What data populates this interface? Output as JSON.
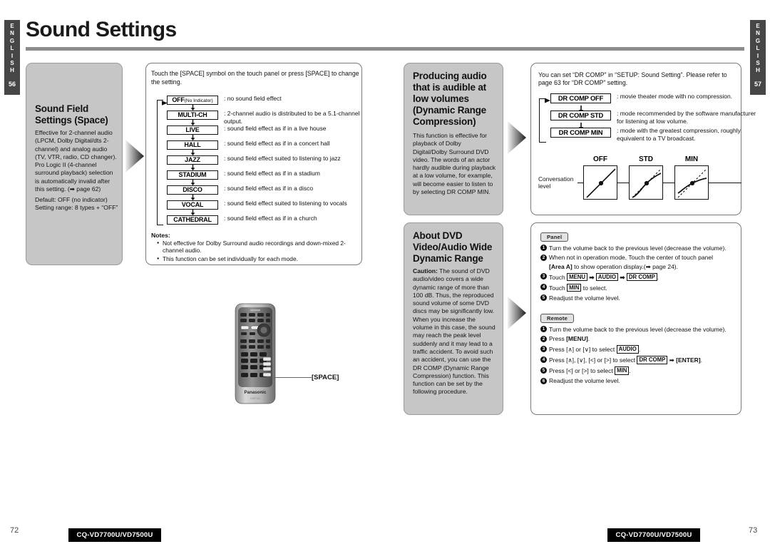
{
  "document": {
    "title": "Sound Settings",
    "left_tab": {
      "letters": [
        "E",
        "N",
        "G",
        "L",
        "I",
        "S",
        "H"
      ],
      "page": "56"
    },
    "right_tab": {
      "letters": [
        "E",
        "N",
        "G",
        "L",
        "I",
        "S",
        "H"
      ],
      "page": "57"
    },
    "footer": {
      "left_page": "72",
      "right_page": "73",
      "left_model": "CQ-VD7700U/VD7500U",
      "right_model": "CQ-VD7700U/VD7500U"
    }
  },
  "sound_field": {
    "heading_line1": "Sound Field",
    "heading_line2": "Settings (Space)",
    "body": "Effective for 2-channel audio (LPCM, Dolby Digital/dts 2-channel) and analog audio (TV, VTR, radio, CD changer). Pro Logic II (4-channel surround playback) selection is automatically invalid after this setting. (➡ page 62)",
    "default_line": "Default: OFF (no indicator)",
    "range_line": "Setting range: 8 types + “OFF”"
  },
  "flow": {
    "intro": "Touch the [SPACE] symbol on the touch panel or press [SPACE] to change the setting.",
    "items": [
      {
        "label": "OFF",
        "sublabel": "(No Indicator)",
        "desc": ": no sound field effect"
      },
      {
        "label": "MULTI-CH",
        "sublabel": "",
        "desc": ": 2-channel audio is distributed to be a 5.1-channel output."
      },
      {
        "label": "LIVE",
        "sublabel": "",
        "desc": ": sound field effect as if in a live house"
      },
      {
        "label": "HALL",
        "sublabel": "",
        "desc": ": sound field effect as if in a concert hall"
      },
      {
        "label": "JAZZ",
        "sublabel": "",
        "desc": ": sound field effect suited to listening to jazz"
      },
      {
        "label": "STADIUM",
        "sublabel": "",
        "desc": ": sound field effect as if in a stadium"
      },
      {
        "label": "DISCO",
        "sublabel": "",
        "desc": ": sound field effect as if in a disco"
      },
      {
        "label": "VOCAL",
        "sublabel": "",
        "desc": ": sound field effect suited to listening to vocals"
      },
      {
        "label": "CATHEDRAL",
        "sublabel": "",
        "desc": ": sound field effect as if in a church"
      }
    ]
  },
  "notes": {
    "heading": "Notes:",
    "items": [
      "Not effective for Dolby Surround audio recordings and down-mixed 2-channel audio.",
      "This function can be set individually for each mode."
    ]
  },
  "remote_figure": {
    "brand": "Panasonic",
    "sub_brand": "CAR AV",
    "callout": "[SPACE]"
  },
  "dynamic_range": {
    "heading_line1": "Producing audio",
    "heading_line2": "that is audible at",
    "heading_line3": "low volumes",
    "heading_line4": "(Dynamic Range",
    "heading_line5": "Compression)",
    "body": "This function is effective for playback of Dolby Digital/Dolby Surround DVD video.  The words of an actor hardly audible during playback at a low volume, for example, will become easier to listen to by selecting DR COMP MIN."
  },
  "about_dvd": {
    "heading_line1": "About DVD",
    "heading_line2": "Video/Audio Wide",
    "heading_line3": "Dynamic Range",
    "caution_label": "Caution:",
    "body": " The sound of DVD audio/video covers a wide dynamic range of more than 100 dB. Thus, the reproduced sound volume of some DVD discs may be significantly low. When you increase the volume in this case, the sound may reach the peak level suddenly and it may lead to a traffic accident. To avoid such an accident, you can use the DR COMP (Dynamic Range Compression) function. This function can be set by the following procedure."
  },
  "dr_comp": {
    "intro": "You can set “DR COMP” in “SETUP: Sound Setting”. Please  refer to page 63 for “DR COMP” setting.",
    "items": [
      {
        "label": "DR COMP OFF",
        "desc": ": movie theater mode with no compression."
      },
      {
        "label": "DR COMP STD",
        "desc": ": mode  recommended  by  the  software manufacturer for listening at low volume."
      },
      {
        "label": "DR COMP MIN",
        "desc": ": mode with the greatest compression, roughly equivalent to a TV broadcast."
      }
    ],
    "graph": {
      "axis_caption_line1": "Conversation",
      "axis_caption_line2": "level",
      "labels": [
        "OFF",
        "STD",
        "MIN"
      ]
    }
  },
  "panel_steps": {
    "tag": "Panel",
    "steps": [
      {
        "num": "❶",
        "text": "Turn the volume back to the previous level (decrease the volume)."
      },
      {
        "num": "❷",
        "text": "When not in operation mode, Touch the center of touch panel"
      },
      {
        "num": "❸",
        "text": "Touch"
      },
      {
        "num": "❹",
        "text": "Touch"
      },
      {
        "num": "❺",
        "text": "Readjust the volume level."
      }
    ],
    "step2_sub_bold": "[Area A]",
    "step2_sub_rest": " to show operation display.(➡  page 24).",
    "step3_keys": [
      "MENU",
      "AUDIO",
      "DR COMP"
    ],
    "step4_key": "MIN",
    "step4_tail": "to select."
  },
  "remote_steps": {
    "tag": "Remote",
    "steps": [
      {
        "num": "❶",
        "text": "Turn the volume back to the previous level (decrease the volume)."
      },
      {
        "num": "❷",
        "prefix": "Press ",
        "bold": "[MENU]",
        "suffix": "."
      },
      {
        "num": "❸",
        "prefix": "Press [∧] or [∨] to select ",
        "key": "AUDIO",
        "suffix": "."
      },
      {
        "num": "❹",
        "prefix": "Press [∧], [∨], [<] or [>] to select ",
        "key": "DR COMP",
        "mid": " ➡ ",
        "bold": "[ENTER]",
        "suffix": "."
      },
      {
        "num": "❺",
        "prefix": "Press [<] or [>] to select ",
        "key": "MIN",
        "suffix": "."
      },
      {
        "num": "❻",
        "text": "Readjust the volume level."
      }
    ]
  },
  "colors": {
    "panel_gray": "#c6c6c6",
    "tab_dark": "#464646",
    "rule_gray": "#8c8c8c",
    "ink": "#111111"
  }
}
